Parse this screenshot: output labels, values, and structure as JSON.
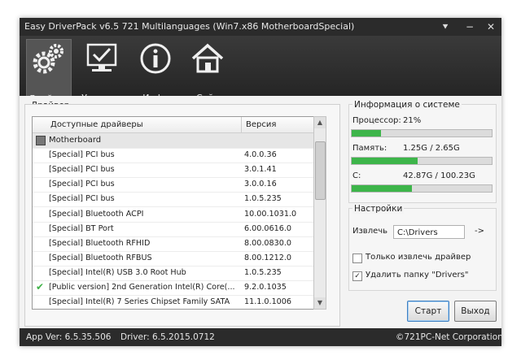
{
  "window": {
    "title": "Easy DriverPack v6.5 721 Multilanguages (Win7.x86 MotherboardSpecial)"
  },
  "titlebar_buttons": {
    "menu": "⯆",
    "minimize": "−",
    "close": "✕"
  },
  "toolbar": {
    "items": [
      {
        "label": "Драйвер",
        "icon": "gears-icon",
        "active": true
      },
      {
        "label": "Утилиты",
        "icon": "monitor-check-icon",
        "active": false
      },
      {
        "label": "Инфо",
        "icon": "info-icon",
        "active": false
      },
      {
        "label": "Сайт",
        "icon": "home-icon",
        "active": false
      }
    ]
  },
  "drivers": {
    "panel_title": "Драйвер",
    "columns": {
      "name": "Доступные драйверы",
      "version": "Версия"
    },
    "rows": [
      {
        "name": "Motherboard",
        "version": "",
        "group": true,
        "checked": false
      },
      {
        "name": "[Special] PCI bus",
        "version": "4.0.0.36",
        "checked": false
      },
      {
        "name": "[Special] PCI bus",
        "version": "3.0.1.41",
        "checked": false
      },
      {
        "name": "[Special] PCI bus",
        "version": "3.0.0.16",
        "checked": false
      },
      {
        "name": "[Special] PCI bus",
        "version": "1.0.5.235",
        "checked": false
      },
      {
        "name": "[Special] Bluetooth ACPI",
        "version": "10.00.1031.0",
        "checked": false
      },
      {
        "name": "[Special] BT Port",
        "version": "6.00.0616.0",
        "checked": false
      },
      {
        "name": "[Special] Bluetooth RFHID",
        "version": "8.00.0830.0",
        "checked": false
      },
      {
        "name": "[Special] Bluetooth RFBUS",
        "version": "8.00.1212.0",
        "checked": false
      },
      {
        "name": "[Special] Intel(R) USB 3.0 Root Hub",
        "version": "1.0.5.235",
        "checked": false
      },
      {
        "name": "[Public version] 2nd Generation Intel(R) Core(...",
        "version": "9.2.0.1035",
        "checked": true
      },
      {
        "name": "[Special] Intel(R) 7 Series Chipset Family SATA",
        "version": "11.1.0.1006",
        "checked": false
      }
    ]
  },
  "sysinfo": {
    "title": "Информация о системе",
    "cpu": {
      "label": "Процессор:",
      "value": "21%",
      "fraction": 0.21
    },
    "memory": {
      "label": "Память:",
      "value": "1.25G / 2.65G",
      "fraction": 0.47
    },
    "disk": {
      "label": "C:",
      "value": "42.87G / 100.23G",
      "fraction": 0.43
    }
  },
  "settings": {
    "title": "Настройки",
    "extract_label": "Извлечь",
    "extract_path": "C:\\Drivers",
    "arrow": "->",
    "only_extract": {
      "label": "Только извлечь драйвер",
      "checked": false
    },
    "delete_folder": {
      "label": "Удалить папку \"Drivers\"",
      "checked": true
    }
  },
  "buttons": {
    "start": "Старт",
    "exit": "Выход"
  },
  "statusbar": {
    "app_ver": "App Ver: 6.5.35.506",
    "driver": "Driver: 6.5.2015.0712",
    "copyright": "©721PC-Net Corporation"
  },
  "colors": {
    "accent": "#3db54a",
    "dark": "#2b2b2b",
    "check": "#3fb247"
  }
}
